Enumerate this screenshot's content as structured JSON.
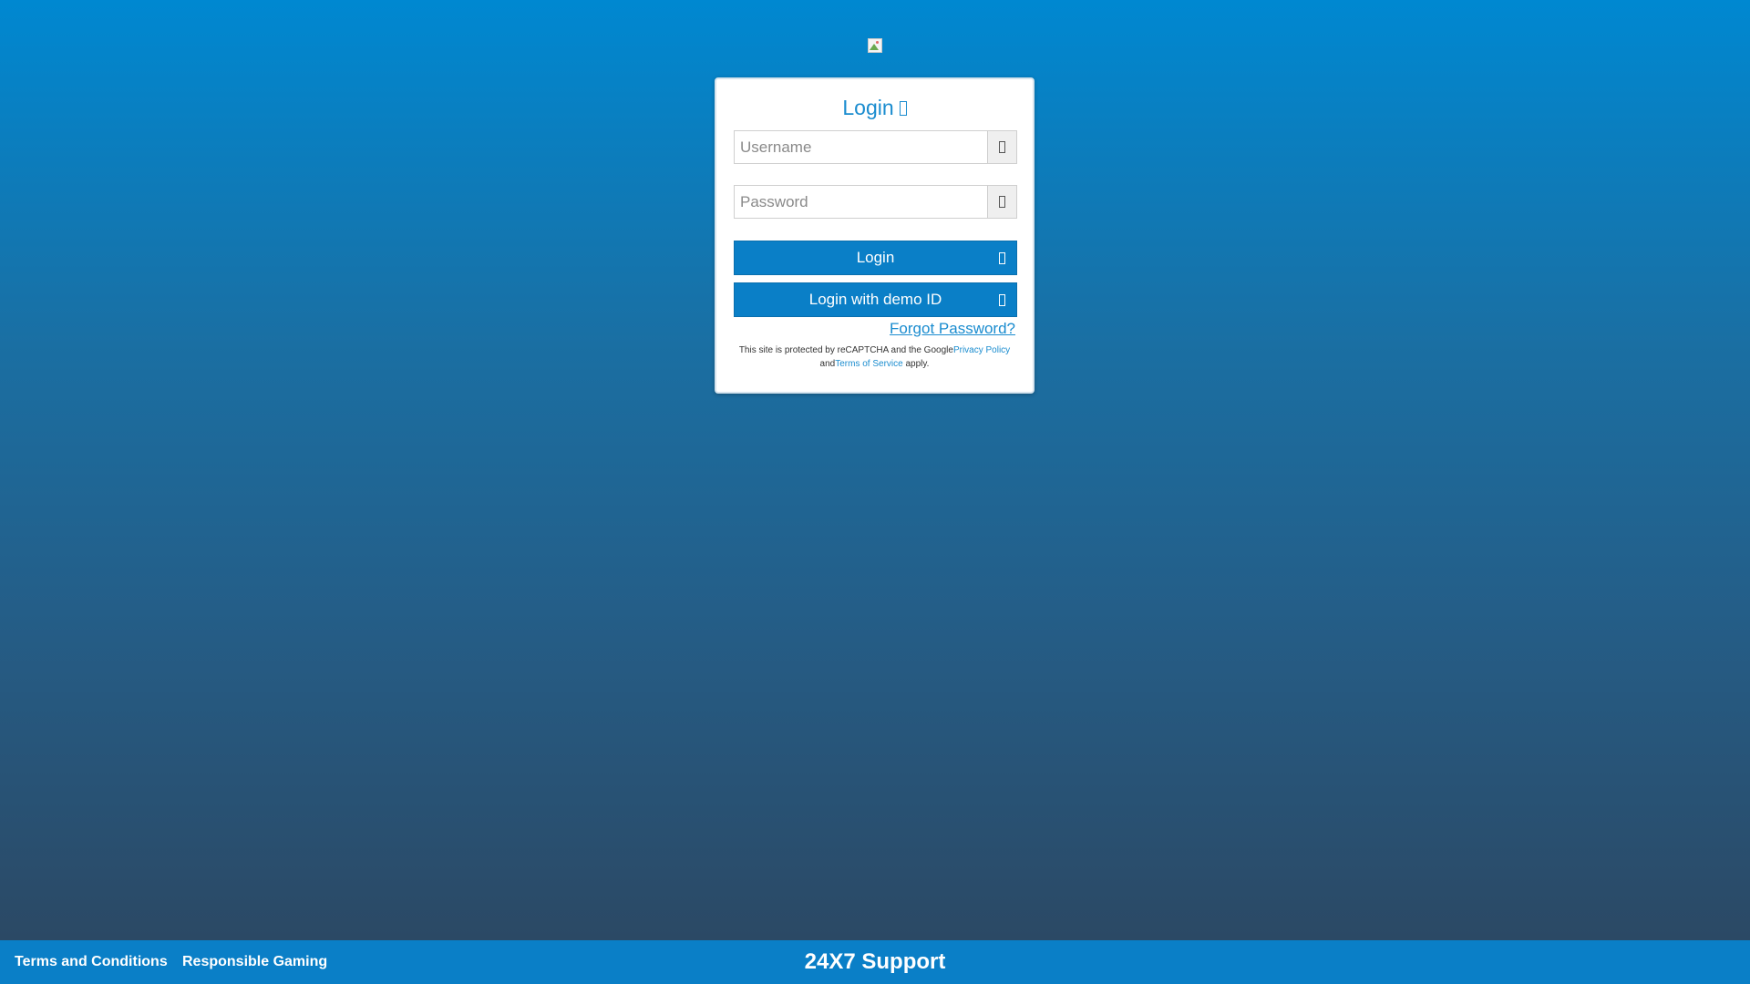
{
  "header": {
    "logo_icon": "broken-image-icon"
  },
  "login_card": {
    "title": "Login",
    "title_icon": "sign-in-icon",
    "username": {
      "placeholder": "Username",
      "value": "",
      "icon": "user-icon"
    },
    "password": {
      "placeholder": "Password",
      "value": "",
      "icon": "key-icon"
    },
    "login_button": {
      "label": "Login",
      "icon": "sign-in-icon"
    },
    "demo_button": {
      "label": "Login with demo ID",
      "icon": "sign-in-icon"
    },
    "forgot_password": "Forgot Password?",
    "recaptcha": {
      "text_1": "This site is protected by reCAPTCHA and the Google",
      "privacy_link": "Privacy Policy",
      "text_2": "and",
      "terms_link": "Terms of Service",
      "text_3": " apply."
    }
  },
  "footer": {
    "terms": "Terms and Conditions",
    "responsible": "Responsible Gaming",
    "support": "24X7 Support"
  },
  "colors": {
    "accent": "#0a7fc7",
    "title": "#1a8ccf",
    "gradient_top": "#0088d1",
    "gradient_bottom": "#2c4660"
  }
}
